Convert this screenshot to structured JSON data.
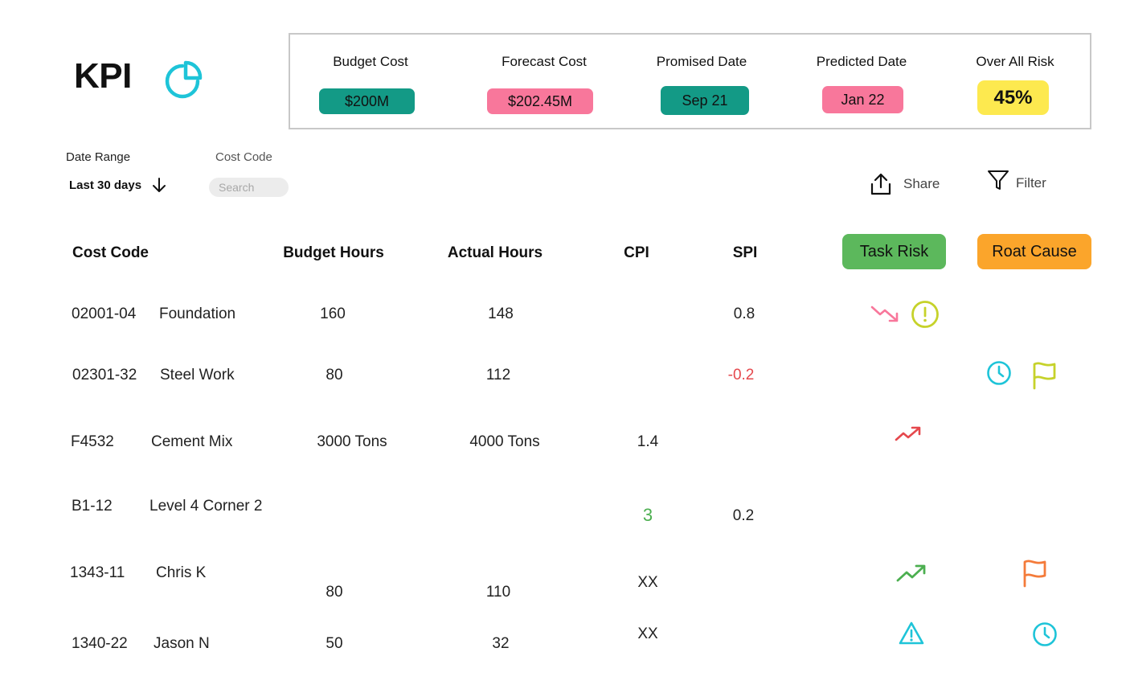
{
  "header": {
    "title": "KPI"
  },
  "summary": [
    {
      "label": "Budget Cost",
      "value": "$200M"
    },
    {
      "label": "Forecast Cost",
      "value": "$202.45M"
    },
    {
      "label": "Promised Date",
      "value": "Sep 21"
    },
    {
      "label": "Predicted Date",
      "value": "Jan 22"
    },
    {
      "label": "Over All Risk",
      "value": "45%"
    }
  ],
  "filters": {
    "date_range_label": "Date Range",
    "date_range_value": "Last 30 days",
    "cost_code_label": "Cost Code",
    "search_placeholder": "Search"
  },
  "actions": {
    "share": "Share",
    "filter": "Filter"
  },
  "table": {
    "headers": {
      "cost_code": "Cost Code",
      "budget_hours": "Budget Hours",
      "actual_hours": "Actual Hours",
      "cpi": "CPI",
      "spi": "SPI",
      "task_risk": "Task Risk",
      "root_cause": "Roat Cause"
    },
    "rows": [
      {
        "code": "02001-04",
        "name": "Foundation",
        "budget": "160",
        "actual": "148",
        "cpi": "",
        "spi": "0.8",
        "task_risk_icons": [
          "trend-down-icon",
          "alert-circle-icon"
        ],
        "root_cause_icons": []
      },
      {
        "code": "02301-32",
        "name": "Steel Work",
        "budget": "80",
        "actual": "112",
        "cpi": "",
        "spi": "-0.2",
        "task_risk_icons": [],
        "root_cause_icons": [
          "clock-icon",
          "flag-icon"
        ]
      },
      {
        "code": "F4532",
        "name": "Cement Mix",
        "budget": "3000 Tons",
        "actual": "4000 Tons",
        "cpi": "1.4",
        "spi": "",
        "task_risk_icons": [
          "trend-up-icon"
        ],
        "root_cause_icons": []
      },
      {
        "code": "B1-12",
        "name": "Level 4 Corner 2",
        "budget": "",
        "actual": "",
        "cpi": "3",
        "spi": "0.2",
        "task_risk_icons": [],
        "root_cause_icons": []
      },
      {
        "code": "1343-11",
        "name": "Chris K",
        "budget": "80",
        "actual": "110",
        "cpi": "XX",
        "spi": "",
        "task_risk_icons": [
          "trend-up-icon"
        ],
        "root_cause_icons": [
          "flag-icon"
        ]
      },
      {
        "code": "1340-22",
        "name": "Jason N",
        "budget": "50",
        "actual": "32",
        "cpi": "XX",
        "spi": "",
        "task_risk_icons": [
          "warning-triangle-icon"
        ],
        "root_cause_icons": [
          "clock-icon"
        ]
      }
    ]
  },
  "colors": {
    "teal": "#139a86",
    "pink": "#f8779b",
    "yellow": "#fde94f",
    "green": "#5cb85c",
    "orange": "#fba52b",
    "cyan": "#1ec4d8",
    "negative": "#e5484d",
    "positive": "#4caf50",
    "lime": "#c6d22a"
  }
}
